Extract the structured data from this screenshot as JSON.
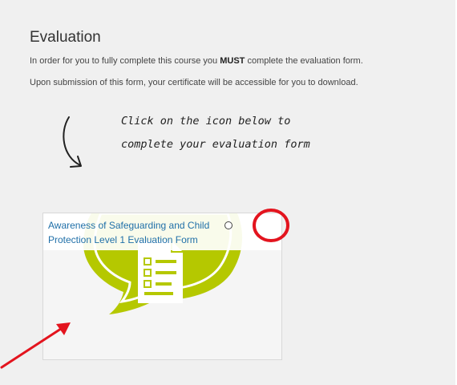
{
  "section": {
    "title": "Evaluation",
    "line1_before": "In order for you to fully complete this course you ",
    "line1_emph": "MUST",
    "line1_after": " complete the evaluation form.",
    "line2": "Upon submission of this form, your certificate will be accessible for you to download."
  },
  "note": {
    "line1": "Click on the icon below to",
    "line2": "complete your evaluation form"
  },
  "card": {
    "link_line1": "Awareness of Safeguarding and Child",
    "link_line2": "Protection Level 1 Evaluation Form"
  },
  "colors": {
    "accent_green": "#b5c800",
    "link_blue": "#1f6fa8",
    "annotation_red": "#e3141e"
  },
  "icons": [
    "curved-arrow-icon",
    "speech-bubble-form-icon",
    "completion-radio-icon",
    "red-arrow-icon"
  ]
}
